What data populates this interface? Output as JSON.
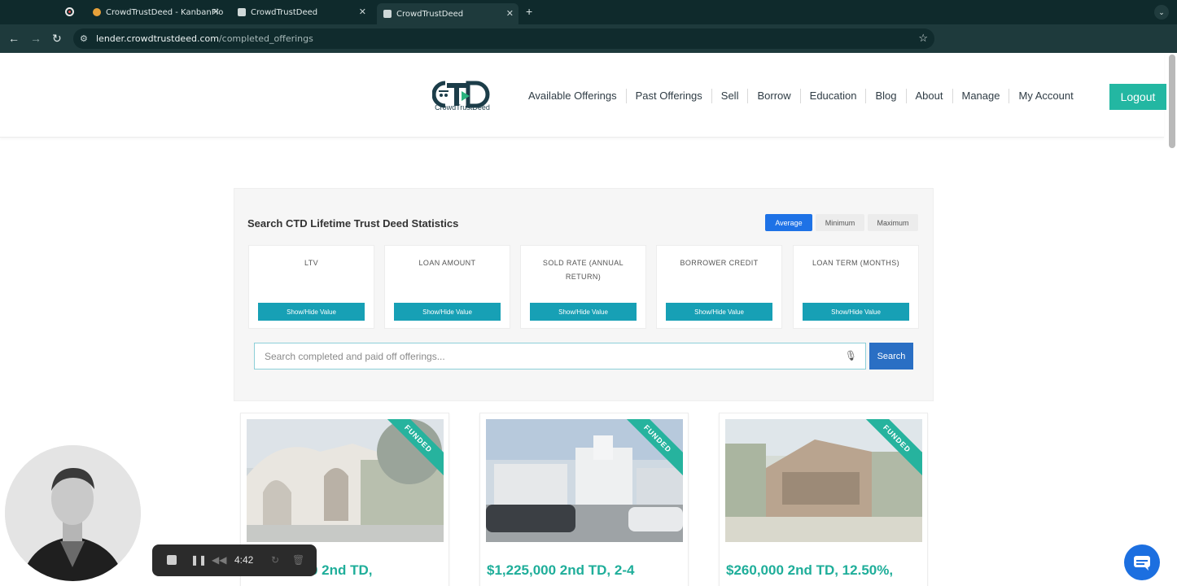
{
  "browser": {
    "tabs": [
      {
        "title": "CrowdTrustDeed - KanbanFlo"
      },
      {
        "title": "CrowdTrustDeed"
      },
      {
        "title": "CrowdTrustDeed"
      }
    ],
    "url_host": "lender.crowdtrustdeed.com",
    "url_path": "/completed_offerings",
    "profile_initial": "M"
  },
  "site": {
    "logo_mark": "CTD",
    "logo_text": "CrowdTrustDeed",
    "nav": [
      "Available Offerings",
      "Past Offerings",
      "Sell",
      "Borrow",
      "Education",
      "Blog",
      "About",
      "Manage",
      "My Account"
    ],
    "logout_label": "Logout"
  },
  "stats": {
    "title": "Search CTD Lifetime Trust Deed Statistics",
    "modes": [
      "Average",
      "Minimum",
      "Maximum"
    ],
    "active_mode": "Average",
    "cards": [
      {
        "label": "LTV",
        "button": "Show/Hide Value"
      },
      {
        "label": "LOAN AMOUNT",
        "button": "Show/Hide Value"
      },
      {
        "label": "SOLD RATE (ANNUAL RETURN)",
        "button": "Show/Hide Value"
      },
      {
        "label": "BORROWER CREDIT",
        "button": "Show/Hide Value"
      },
      {
        "label": "LOAN TERM (MONTHS)",
        "button": "Show/Hide Value"
      }
    ],
    "search_placeholder": "Search completed and paid off offerings...",
    "search_button": "Search"
  },
  "offerings": [
    {
      "ribbon": "FUNDED",
      "title": "0 2nd TD,"
    },
    {
      "ribbon": "FUNDED",
      "title": "$1,225,000 2nd TD, 2-4"
    },
    {
      "ribbon": "FUNDED",
      "title": "$260,000 2nd TD, 12.50%,"
    }
  ],
  "recorder": {
    "time": "4:42"
  },
  "colors": {
    "brand_teal": "#23b7a2",
    "button_teal": "#17a0b5",
    "active_blue": "#1e72e6",
    "chrome_bg": "#1e3a3c"
  }
}
